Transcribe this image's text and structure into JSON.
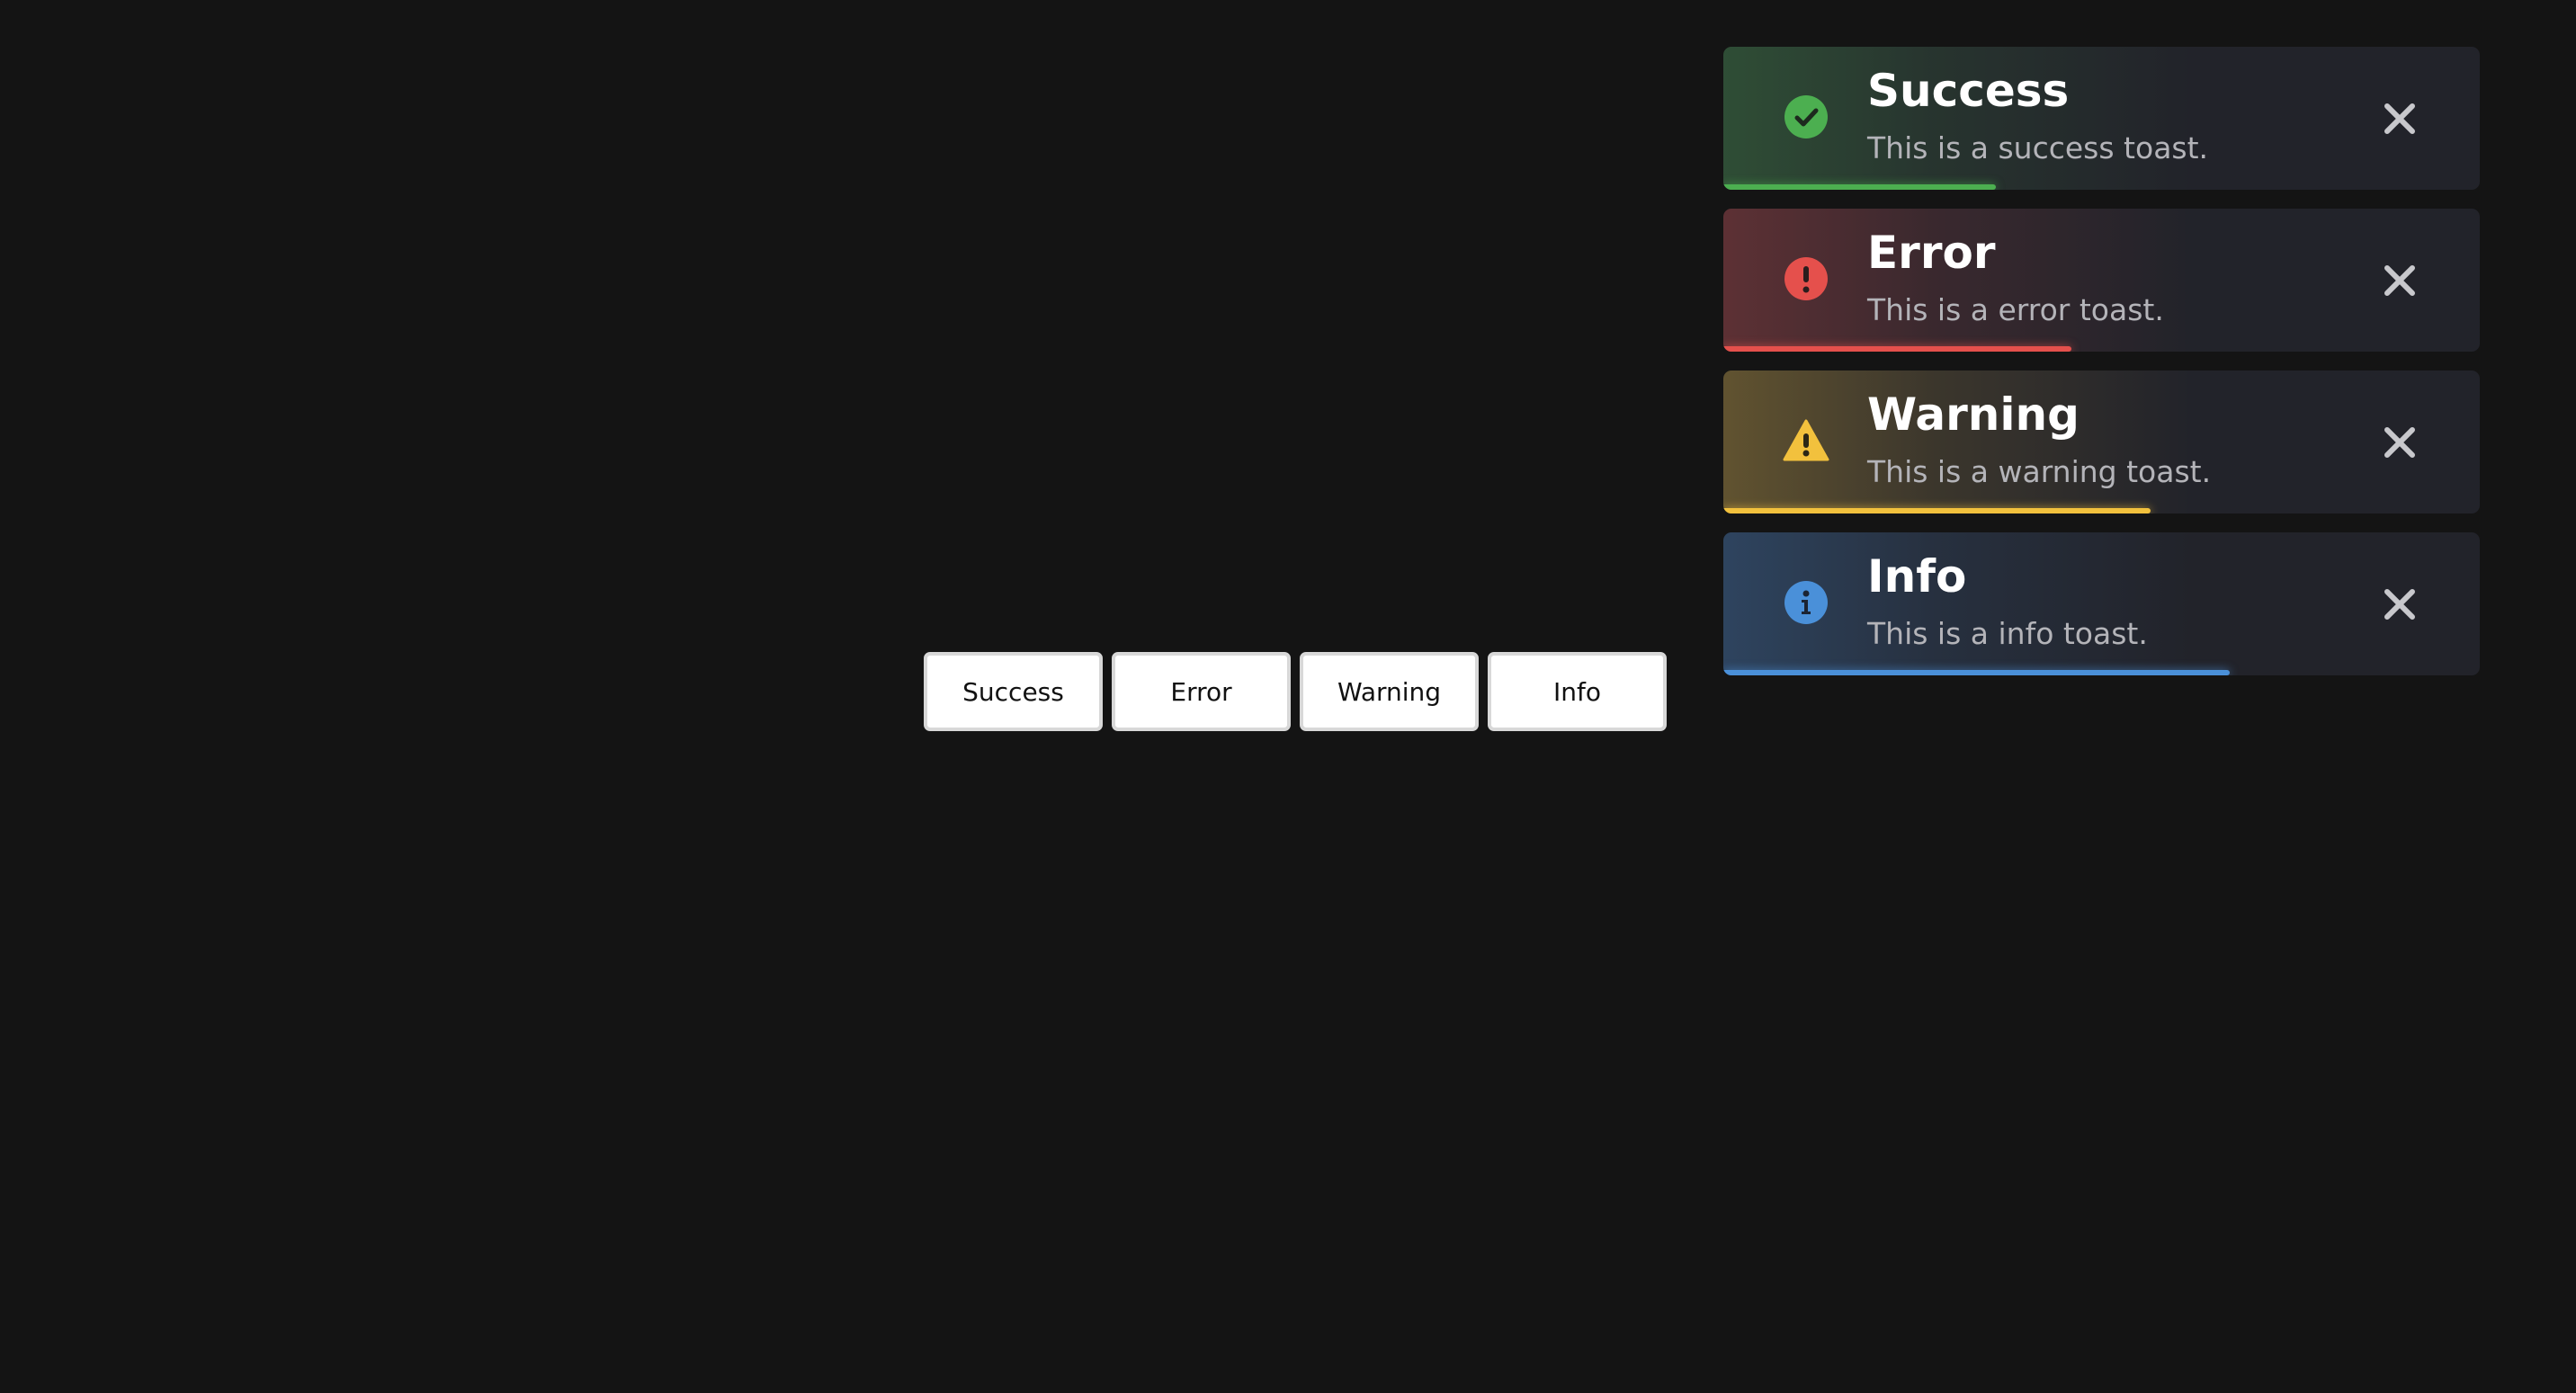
{
  "buttons": {
    "success": "Success",
    "error": "Error",
    "warning": "Warning",
    "info": "Info"
  },
  "toasts": [
    {
      "type": "success",
      "title": "Success",
      "message": "This is a success toast.",
      "icon": "check-circle-icon",
      "color": "#4caf50",
      "progress": 0.36
    },
    {
      "type": "error",
      "title": "Error",
      "message": "This is a error toast.",
      "icon": "exclamation-circle-icon",
      "color": "#e5504c",
      "progress": 0.46
    },
    {
      "type": "warning",
      "title": "Warning",
      "message": "This is a warning toast.",
      "icon": "warning-triangle-icon",
      "color": "#f2c13d",
      "progress": 0.565
    },
    {
      "type": "info",
      "title": "Info",
      "message": "This is a info toast.",
      "icon": "info-circle-icon",
      "color": "#4a90d9",
      "progress": 0.67
    }
  ],
  "close_icon": "close-icon"
}
